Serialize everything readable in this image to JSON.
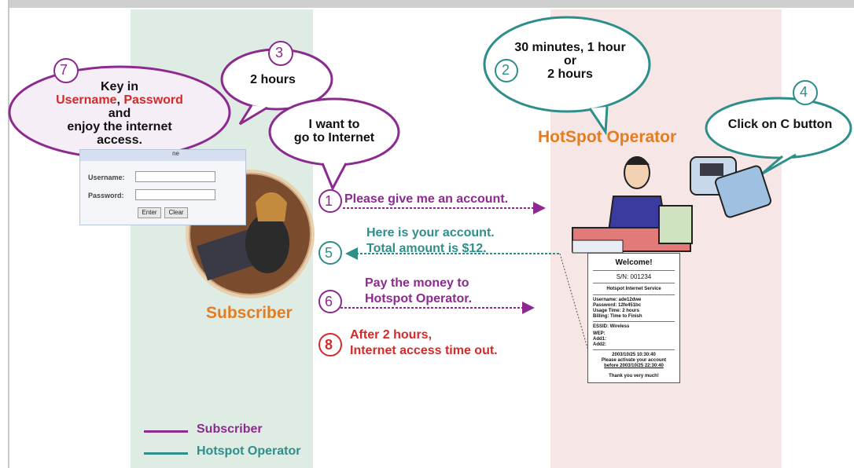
{
  "colors": {
    "subscriber": "#8c2a8f",
    "operator": "#2e8e8a",
    "alert": "#d42a2a",
    "role_label": "#e27d22"
  },
  "bubbles": {
    "b7": {
      "num": "7",
      "line1": "Key in",
      "username": "Username",
      "sep": ", ",
      "password": "Password",
      "line3": "and",
      "line4": "enjoy the internet",
      "line5": "access."
    },
    "b3": {
      "num": "3",
      "text": "2 hours"
    },
    "b1": {
      "line1": "I want to",
      "line2": "go to Internet"
    },
    "b2": {
      "num": "2",
      "line1": "30 minutes, 1 hour",
      "line2": "or",
      "line3": "2 hours"
    },
    "b4": {
      "num": "4",
      "text": "Click on C button"
    }
  },
  "login_box": {
    "username_label": "Username:",
    "password_label": "Password:",
    "enter_button": "Enter",
    "clear_button": "Clear",
    "header_text": "ne"
  },
  "roles": {
    "operator": "HotSpot Operator",
    "subscriber": "Subscriber"
  },
  "steps": [
    {
      "num": "1",
      "line1": "Please give me an account.",
      "line2": ""
    },
    {
      "num": "5",
      "line1": "Here is your account.",
      "line2": "Total amount is $12."
    },
    {
      "num": "6",
      "line1": "Pay the money to",
      "line2": "Hotspot Operator."
    },
    {
      "num": "8",
      "line1": "After 2 hours,",
      "line2": "Internet access time out."
    }
  ],
  "receipt": {
    "title": "Welcome!",
    "sn": "S/N: 001234",
    "service": "Hotspot Internet Service",
    "lines1": [
      "Username: ade12dwe",
      "Password: 12fe451bc",
      "Usage Time: 2 hours",
      "Billing: Time to Finish"
    ],
    "lines2": [
      "ESSID: Wireless",
      "WEP:",
      "Add1:",
      "Add2:"
    ],
    "lines3": [
      "2003/10/25 10:30:40",
      "Please activate your account",
      "before 2003/10/25 22:30:40"
    ],
    "thanks": "Thank you very much!"
  },
  "legend": [
    {
      "label": "Subscriber",
      "color": "#8c2a8f"
    },
    {
      "label": "Hotspot Operator",
      "color": "#2e8e8a"
    }
  ]
}
